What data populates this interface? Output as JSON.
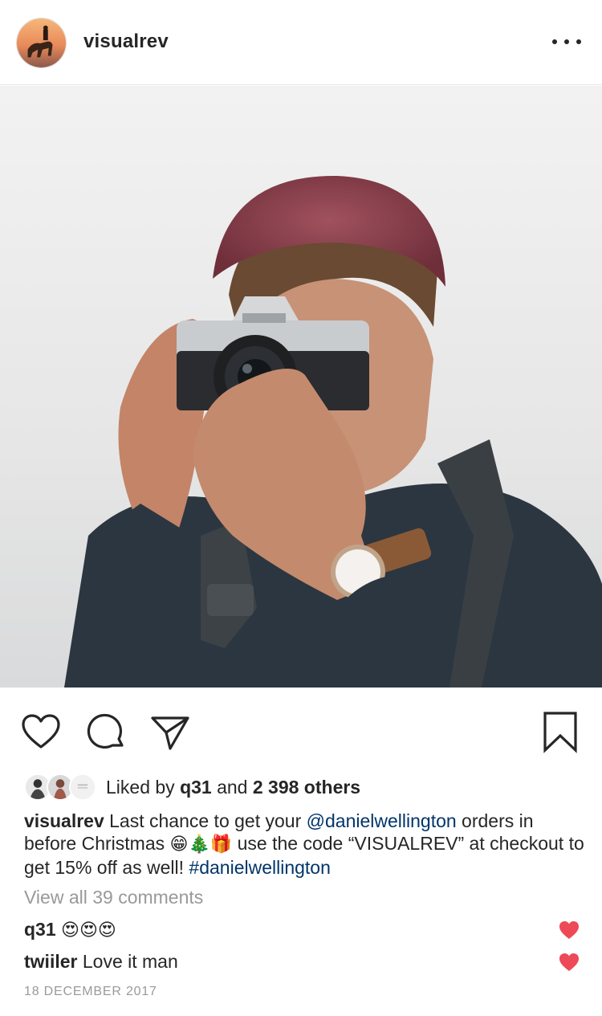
{
  "post": {
    "username": "visualrev",
    "more_icon": "more-horizontal-icon"
  },
  "actions": {
    "like_icon": "heart-outline-icon",
    "comment_icon": "comment-bubble-icon",
    "share_icon": "paper-plane-icon",
    "save_icon": "bookmark-icon"
  },
  "likes": {
    "prefix": "Liked by ",
    "user": "q31",
    "middle": " and ",
    "others": "2 398 others"
  },
  "caption": {
    "username": "visualrev",
    "text_1": " Last chance to get your ",
    "mention": "@danielwellington",
    "text_2": " orders in before Christmas ",
    "emojis": "😁🎄🎁",
    "text_3": " use the code “VISUALREV” at checkout to get 15% off as well! ",
    "hashtag": "#danielwellington"
  },
  "view_comments": "View all 39 comments",
  "comments": [
    {
      "user": "q31",
      "text": "😍😍😍",
      "liked": true
    },
    {
      "user": "twiiler",
      "text": "Love it man",
      "liked": true
    }
  ],
  "date": "18 DECEMBER 2017",
  "colors": {
    "text": "#262626",
    "muted": "#999999",
    "link": "#003569",
    "heart": "#ed4956"
  }
}
